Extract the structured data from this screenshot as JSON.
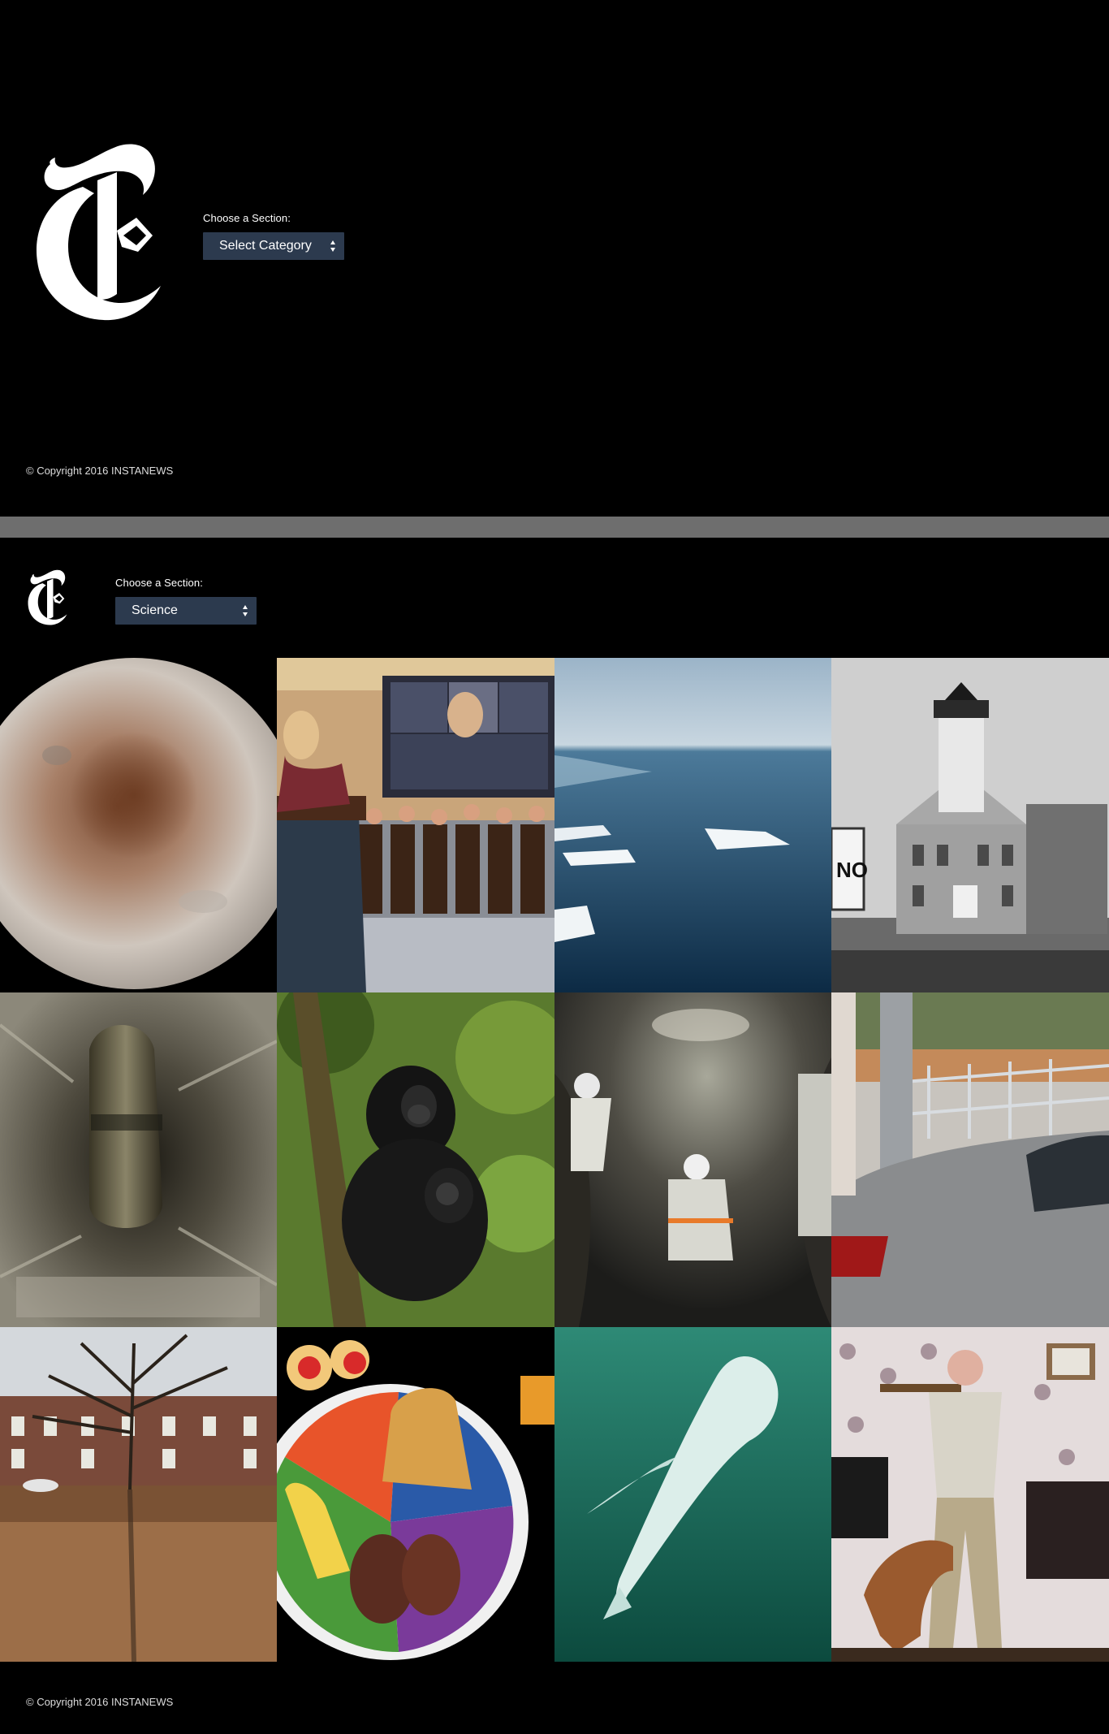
{
  "landing": {
    "logo_icon": "nyt-t-logo",
    "chooser_label": "Choose a Section:",
    "select_value": "Select Category",
    "copyright": "© Copyright 2016 INSTANEWS"
  },
  "results": {
    "logo_icon": "nyt-t-logo",
    "chooser_label": "Choose a Section:",
    "select_value": "Science",
    "copyright": "© Copyright 2016 INSTANEWS",
    "stories": [
      {
        "image": "planet-charon-photo"
      },
      {
        "image": "congressional-hearing-photo"
      },
      {
        "image": "arctic-sea-ice-photo"
      },
      {
        "image": "stone-lighthouse-photo"
      },
      {
        "image": "missile-silo-photo"
      },
      {
        "image": "bonobo-mother-baby-photo"
      },
      {
        "image": "cave-researchers-photo"
      },
      {
        "image": "car-and-pole-street-photo"
      },
      {
        "image": "flooded-street-tree-photo"
      },
      {
        "image": "food-plate-photo"
      },
      {
        "image": "beluga-whale-photo"
      },
      {
        "image": "man-with-dog-photo"
      }
    ]
  },
  "colors": {
    "background": "#000000",
    "select_bg": "#2c3a4e",
    "separator": "#6e6e6e"
  }
}
